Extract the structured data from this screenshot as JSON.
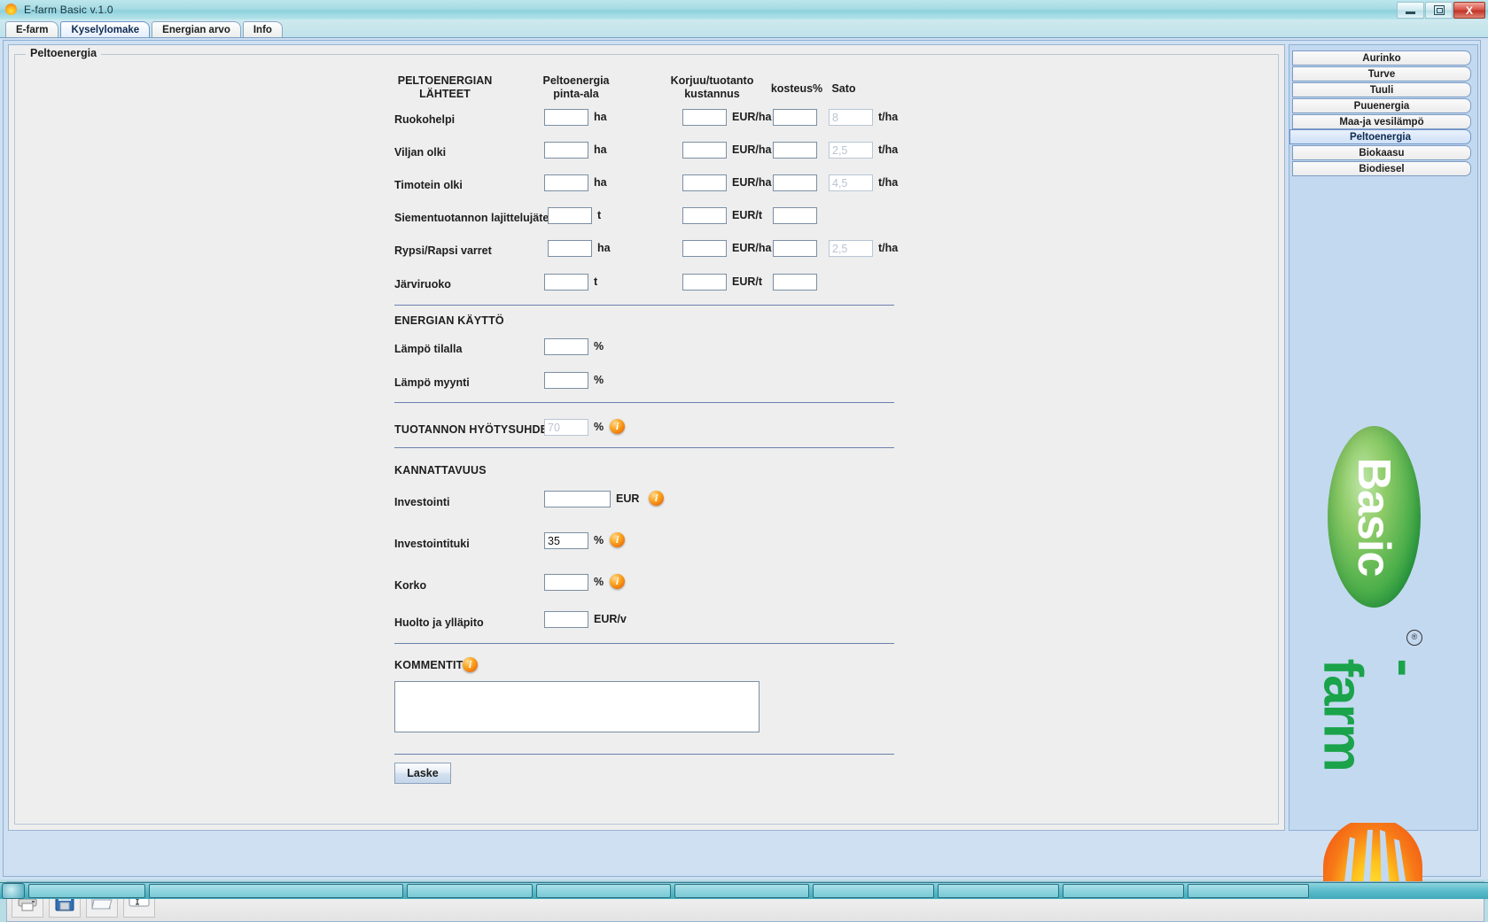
{
  "window": {
    "title": "E-farm Basic v.1.0",
    "app_icon": "sun-icon",
    "controls": {
      "minimize": "minimize-icon",
      "restore": "restore-icon",
      "close": "X"
    }
  },
  "tabs": [
    {
      "label": "E-farm",
      "active": false
    },
    {
      "label": "Kyselylomake",
      "active": true
    },
    {
      "label": "Energian arvo",
      "active": false
    },
    {
      "label": "Info",
      "active": false
    }
  ],
  "panel": {
    "group_title": "Peltoenergia"
  },
  "form": {
    "headers": {
      "sources": "PELTOENERGIAN\nLÄHTEET",
      "sources_line1": "PELTOENERGIAN",
      "sources_line2": "LÄHTEET",
      "area_line1": "Peltoenergia",
      "area_line2": "pinta-ala",
      "cost_line1": "Korjuu/tuotanto",
      "cost_line2": "kustannus",
      "moisture": "kosteus%",
      "yield": "Sato"
    },
    "rows": [
      {
        "label": "Ruokohelpi",
        "area_value": "",
        "area_unit": "ha",
        "cost_value": "",
        "cost_unit": "EUR/ha",
        "moisture_value": "",
        "yield_value": "8",
        "yield_ghost": true,
        "yield_unit": "t/ha"
      },
      {
        "label": "Viljan olki",
        "area_value": "",
        "area_unit": "ha",
        "cost_value": "",
        "cost_unit": "EUR/ha",
        "moisture_value": "",
        "yield_value": "2,5",
        "yield_ghost": true,
        "yield_unit": "t/ha"
      },
      {
        "label": "Timotein olki",
        "area_value": "",
        "area_unit": "ha",
        "cost_value": "",
        "cost_unit": "EUR/ha",
        "moisture_value": "",
        "yield_value": "4,5",
        "yield_ghost": true,
        "yield_unit": "t/ha"
      },
      {
        "label": "Siementuotannon lajittelujäte",
        "area_value": "",
        "area_unit": "t",
        "cost_value": "",
        "cost_unit": "EUR/t",
        "moisture_value": "",
        "yield_value": "",
        "yield_ghost": false,
        "yield_unit": ""
      },
      {
        "label": "Rypsi/Rapsi varret",
        "area_value": "",
        "area_unit": "ha",
        "cost_value": "",
        "cost_unit": "EUR/ha",
        "moisture_value": "",
        "yield_value": "2,5",
        "yield_ghost": true,
        "yield_unit": "t/ha"
      },
      {
        "label": "Järviruoko",
        "area_value": "",
        "area_unit": "t",
        "cost_value": "",
        "cost_unit": "EUR/t",
        "moisture_value": "",
        "yield_value": "",
        "yield_ghost": false,
        "yield_unit": ""
      }
    ],
    "energy_use": {
      "section": "ENERGIAN KÄYTTÖ",
      "rows": [
        {
          "label": "Lämpö tilalla",
          "value": "",
          "unit": "%"
        },
        {
          "label": "Lämpö myynti",
          "value": "",
          "unit": "%"
        }
      ]
    },
    "efficiency": {
      "label": "TUOTANNON HYÖTYSUHDE",
      "value": "70",
      "ghost": true,
      "unit": "%",
      "info": "i"
    },
    "profitability": {
      "section": "KANNATTAVUUS",
      "rows": [
        {
          "label": "Investointi",
          "value": "",
          "ghost": false,
          "unit": "EUR",
          "info": "i"
        },
        {
          "label": "Investointituki",
          "value": "35",
          "ghost": false,
          "unit": "%",
          "info": "i"
        },
        {
          "label": "Korko",
          "value": "",
          "ghost": false,
          "unit": "%",
          "info": "i"
        },
        {
          "label": "Huolto ja ylläpito",
          "value": "",
          "ghost": false,
          "unit": "EUR/v",
          "info": ""
        }
      ]
    },
    "comments": {
      "label": "KOMMENTIT",
      "info": "i",
      "value": ""
    },
    "calc_button": "Laske"
  },
  "sidebar": {
    "items": [
      {
        "label": "Aurinko",
        "active": false
      },
      {
        "label": "Turve",
        "active": false
      },
      {
        "label": "Tuuli",
        "active": false
      },
      {
        "label": "Puuenergia",
        "active": false
      },
      {
        "label": "Maa-ja vesilämpö",
        "active": false
      },
      {
        "label": "Peltoenergia",
        "active": true
      },
      {
        "label": "Biokaasu",
        "active": false
      },
      {
        "label": "Biodiesel",
        "active": false
      }
    ],
    "logo": {
      "badge": "Basic",
      "wordmark": "-farm",
      "registered": "®",
      "sun": "sun-icon"
    }
  },
  "toolbar": {
    "buttons": [
      {
        "name": "print-icon",
        "title": "Print"
      },
      {
        "name": "save-icon",
        "title": "Save"
      },
      {
        "name": "open-folder-icon",
        "title": "Open"
      },
      {
        "name": "text-field-icon",
        "title": "Text"
      }
    ]
  },
  "colors": {
    "accent": "#6f93c8",
    "panel_bg": "#eeeeee",
    "side_bg": "#c3d9f0",
    "info_orange": "#f07c10",
    "logo_green": "#1aa34a"
  }
}
